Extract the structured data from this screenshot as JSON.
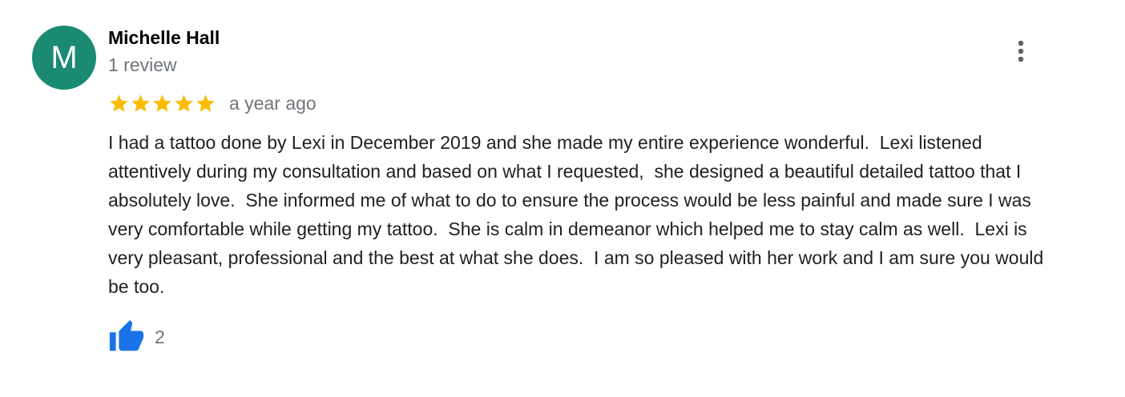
{
  "reviewer": {
    "avatar_letter": "M",
    "avatar_color": "#1a8a73",
    "name": "Michelle Hall",
    "review_count": "1 review"
  },
  "rating": {
    "stars": 5,
    "max_stars": 5,
    "star_color": "#fbbc04",
    "time_ago": "a year ago"
  },
  "review_text": "I had a tattoo done by Lexi in December 2019 and she made my entire experience wonderful.  Lexi listened attentively during my consultation and based on what I requested,  she designed a beautiful detailed tattoo that I absolutely love.  She informed me of what to do to ensure the process would be less painful and made sure I was very comfortable while getting my tattoo.  She is calm in demeanor which helped me to stay calm as well.  Lexi is  very pleasant, professional and the best at what she does.  I am so pleased with her work and I am sure you would be too.",
  "actions": {
    "more_icon": "more-vert-icon",
    "like_icon": "thumbs-up-icon",
    "like_color": "#1a73e8",
    "like_count": "2"
  }
}
